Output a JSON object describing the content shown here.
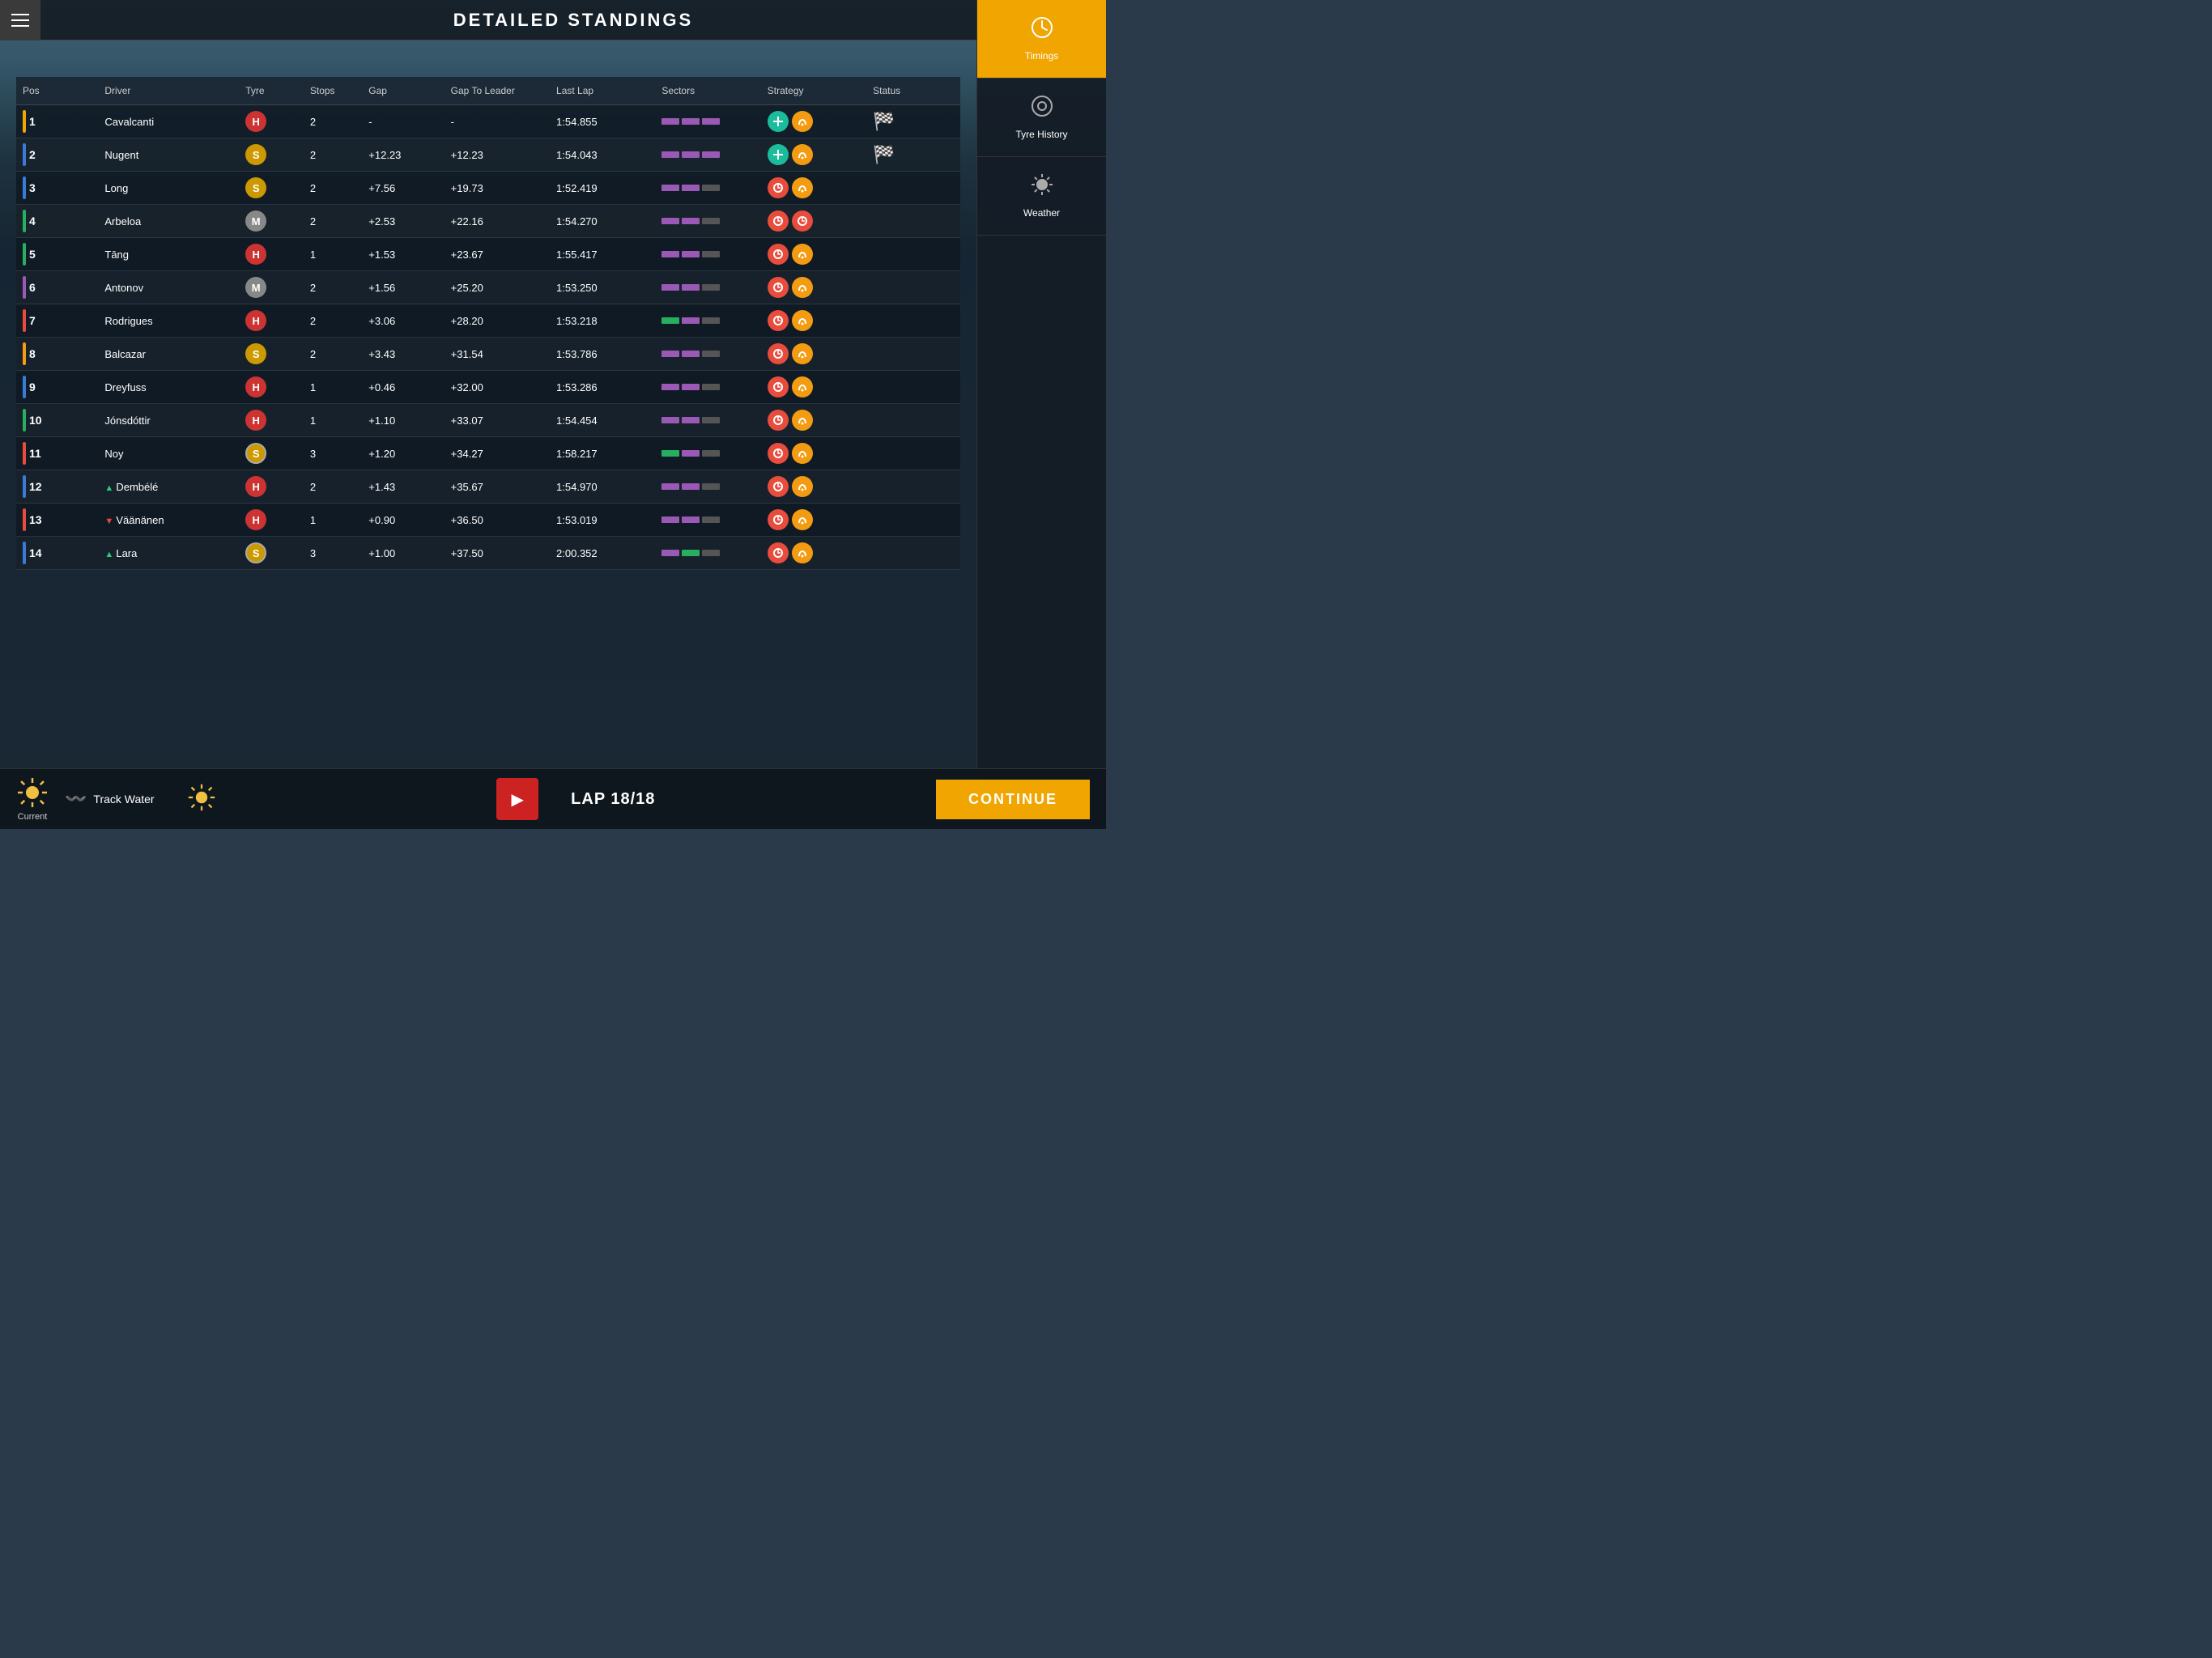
{
  "header": {
    "title": "DETAILED STANDINGS",
    "menu_label": "menu"
  },
  "table": {
    "columns": [
      "Pos",
      "Driver",
      "Tyre",
      "Stops",
      "Gap",
      "Gap To Leader",
      "Last Lap",
      "Sectors",
      "Strategy",
      "Status"
    ],
    "rows": [
      {
        "pos": 1,
        "color": "#f0a500",
        "driver": "Cavalcanti",
        "tyre": "H",
        "tyre_class": "tyre-h",
        "stops": 2,
        "gap": "-",
        "gap_leader": "-",
        "last_lap": "1:54.855",
        "sectors": [
          "purple",
          "purple",
          "purple"
        ],
        "strategy": [
          "teal",
          "yellow"
        ],
        "status": "checkered",
        "trend": ""
      },
      {
        "pos": 2,
        "color": "#3a7bd5",
        "driver": "Nugent",
        "tyre": "S",
        "tyre_class": "tyre-s",
        "stops": 2,
        "gap": "+12.23",
        "gap_leader": "+12.23",
        "last_lap": "1:54.043",
        "sectors": [
          "purple",
          "purple",
          "purple"
        ],
        "strategy": [
          "teal",
          "yellow"
        ],
        "status": "checkered",
        "trend": ""
      },
      {
        "pos": 3,
        "color": "#3a7bd5",
        "driver": "Long",
        "tyre": "S",
        "tyre_class": "tyre-s",
        "stops": 2,
        "gap": "+7.56",
        "gap_leader": "+19.73",
        "last_lap": "1:52.419",
        "sectors": [
          "purple",
          "purple",
          "gray"
        ],
        "strategy": [
          "red",
          "yellow"
        ],
        "status": "",
        "trend": ""
      },
      {
        "pos": 4,
        "color": "#27ae60",
        "driver": "Arbeloa",
        "tyre": "M",
        "tyre_class": "tyre-m",
        "stops": 2,
        "gap": "+2.53",
        "gap_leader": "+22.16",
        "last_lap": "1:54.270",
        "sectors": [
          "purple",
          "purple",
          "gray"
        ],
        "strategy": [
          "red",
          "red"
        ],
        "status": "",
        "trend": ""
      },
      {
        "pos": 5,
        "color": "#27ae60",
        "driver": "Tāng",
        "tyre": "H",
        "tyre_class": "tyre-h",
        "stops": 1,
        "gap": "+1.53",
        "gap_leader": "+23.67",
        "last_lap": "1:55.417",
        "sectors": [
          "purple",
          "purple",
          "gray"
        ],
        "strategy": [
          "red",
          "yellow"
        ],
        "status": "",
        "trend": ""
      },
      {
        "pos": 6,
        "color": "#9b59b6",
        "driver": "Antonov",
        "tyre": "M",
        "tyre_class": "tyre-m",
        "stops": 2,
        "gap": "+1.56",
        "gap_leader": "+25.20",
        "last_lap": "1:53.250",
        "sectors": [
          "purple",
          "purple",
          "gray"
        ],
        "strategy": [
          "red",
          "yellow"
        ],
        "status": "",
        "trend": ""
      },
      {
        "pos": 7,
        "color": "#e74c3c",
        "driver": "Rodrigues",
        "tyre": "H",
        "tyre_class": "tyre-h",
        "stops": 2,
        "gap": "+3.06",
        "gap_leader": "+28.20",
        "last_lap": "1:53.218",
        "sectors": [
          "green",
          "purple",
          "gray"
        ],
        "strategy": [
          "red",
          "yellow"
        ],
        "status": "",
        "trend": ""
      },
      {
        "pos": 8,
        "color": "#f39c12",
        "driver": "Balcazar",
        "tyre": "S",
        "tyre_class": "tyre-s",
        "stops": 2,
        "gap": "+3.43",
        "gap_leader": "+31.54",
        "last_lap": "1:53.786",
        "sectors": [
          "purple",
          "purple",
          "gray"
        ],
        "strategy": [
          "red",
          "yellow"
        ],
        "status": "",
        "trend": ""
      },
      {
        "pos": 9,
        "color": "#3a7bd5",
        "driver": "Dreyfuss",
        "tyre": "H",
        "tyre_class": "tyre-h",
        "stops": 1,
        "gap": "+0.46",
        "gap_leader": "+32.00",
        "last_lap": "1:53.286",
        "sectors": [
          "purple",
          "purple",
          "gray"
        ],
        "strategy": [
          "red",
          "yellow"
        ],
        "status": "",
        "trend": ""
      },
      {
        "pos": 10,
        "color": "#27ae60",
        "driver": "Jónsdóttir",
        "tyre": "H",
        "tyre_class": "tyre-h",
        "stops": 1,
        "gap": "+1.10",
        "gap_leader": "+33.07",
        "last_lap": "1:54.454",
        "sectors": [
          "purple",
          "purple",
          "gray"
        ],
        "strategy": [
          "red",
          "yellow"
        ],
        "status": "",
        "trend": ""
      },
      {
        "pos": 11,
        "color": "#e74c3c",
        "driver": "Noy",
        "tyre": "S",
        "tyre_class": "tyre-c",
        "stops": 3,
        "gap": "+1.20",
        "gap_leader": "+34.27",
        "last_lap": "1:58.217",
        "sectors": [
          "green",
          "purple",
          "gray"
        ],
        "strategy": [
          "red",
          "yellow"
        ],
        "status": "",
        "trend": ""
      },
      {
        "pos": 12,
        "color": "#3a7bd5",
        "driver": "Dembélé",
        "tyre": "H",
        "tyre_class": "tyre-h",
        "stops": 2,
        "gap": "+1.43",
        "gap_leader": "+35.67",
        "last_lap": "1:54.970",
        "sectors": [
          "purple",
          "purple",
          "gray"
        ],
        "strategy": [
          "red",
          "yellow"
        ],
        "status": "",
        "trend": "up"
      },
      {
        "pos": 13,
        "color": "#e74c3c",
        "driver": "Väänänen",
        "tyre": "H",
        "tyre_class": "tyre-h",
        "stops": 1,
        "gap": "+0.90",
        "gap_leader": "+36.50",
        "last_lap": "1:53.019",
        "sectors": [
          "purple",
          "purple",
          "gray"
        ],
        "strategy": [
          "red",
          "yellow"
        ],
        "status": "",
        "trend": "down"
      },
      {
        "pos": 14,
        "color": "#3a7bd5",
        "driver": "Lara",
        "tyre": "S",
        "tyre_class": "tyre-c",
        "stops": 3,
        "gap": "+1.00",
        "gap_leader": "+37.50",
        "last_lap": "2:00.352",
        "sectors": [
          "purple",
          "green",
          "gray"
        ],
        "strategy": [
          "red",
          "yellow"
        ],
        "status": "",
        "trend": "up"
      }
    ]
  },
  "sidebar": {
    "items": [
      {
        "id": "timings",
        "label": "Timings",
        "icon": "⏱",
        "active": true
      },
      {
        "id": "tyre-history",
        "label": "Tyre History",
        "icon": "◎"
      },
      {
        "id": "weather",
        "label": "Weather",
        "icon": "☀"
      }
    ]
  },
  "bottom_bar": {
    "current_label": "Current",
    "track_water_label": "Track Water",
    "lap_info": "LAP 18/18",
    "continue_label": "CONTINUE"
  }
}
